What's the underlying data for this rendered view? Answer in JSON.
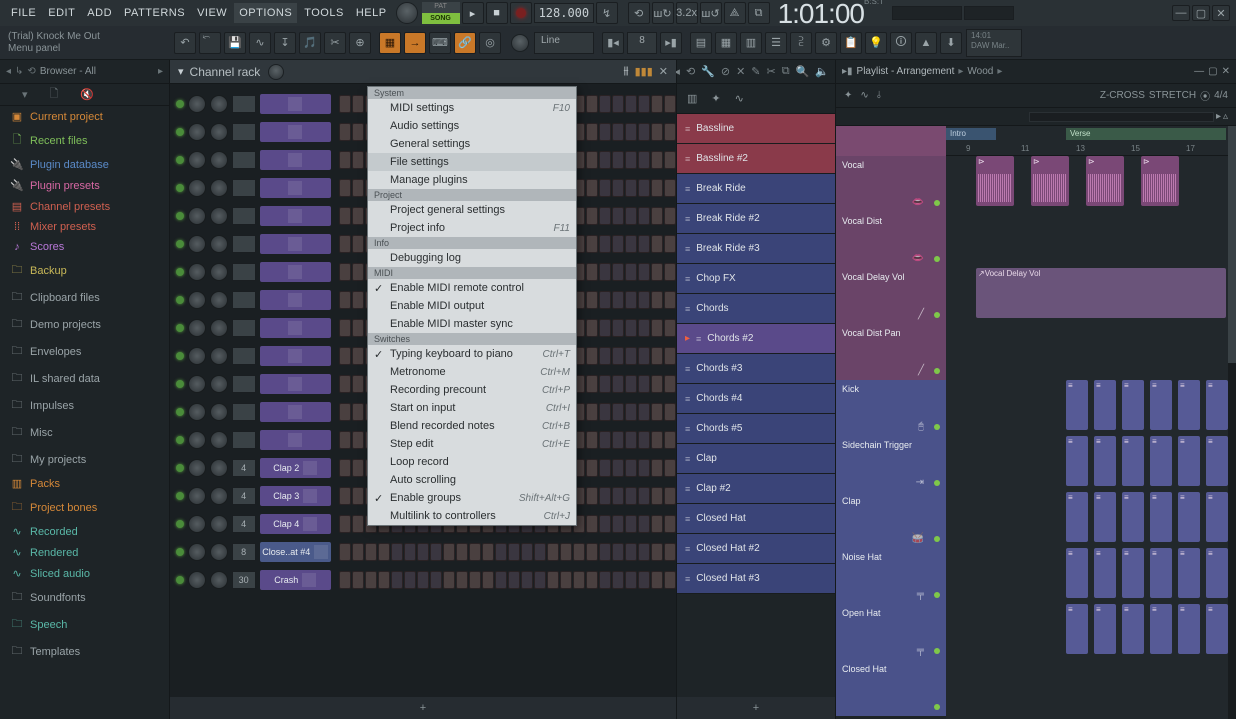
{
  "menu": [
    "FILE",
    "EDIT",
    "ADD",
    "PATTERNS",
    "VIEW",
    "OPTIONS",
    "TOOLS",
    "HELP"
  ],
  "menu_active": "OPTIONS",
  "pat_label": "PAT",
  "song_label": "SONG",
  "tempo": "128.000",
  "clock": "1:01:00",
  "clock_mode": "B:S:T",
  "hint_line1": "(Trial) Knock Me Out",
  "hint_line2": "Menu panel",
  "combo_line": "Line",
  "combo_num": "8",
  "daw_time": "14:01",
  "daw_text": "DAW Mar..",
  "browser_title": "Browser - All",
  "browser_items": [
    {
      "label": "Current project",
      "cls": "c-orange",
      "ico": "▣"
    },
    {
      "label": "Recent files",
      "cls": "c-green",
      "ico": "🗋"
    },
    {
      "label": "Plugin database",
      "cls": "c-blue",
      "ico": "🔌"
    },
    {
      "label": "Plugin presets",
      "cls": "c-pink",
      "ico": "🔌"
    },
    {
      "label": "Channel presets",
      "cls": "c-red",
      "ico": "▤"
    },
    {
      "label": "Mixer presets",
      "cls": "c-red",
      "ico": "⁞⁞"
    },
    {
      "label": "Scores",
      "cls": "c-purple",
      "ico": "♪"
    },
    {
      "label": "Backup",
      "cls": "c-yellow",
      "ico": "🗀"
    },
    {
      "label": "Clipboard files",
      "cls": "c-gray",
      "ico": "🗀"
    },
    {
      "label": "Demo projects",
      "cls": "c-gray",
      "ico": "🗀"
    },
    {
      "label": "Envelopes",
      "cls": "c-gray",
      "ico": "🗀"
    },
    {
      "label": "IL shared data",
      "cls": "c-gray",
      "ico": "🗀"
    },
    {
      "label": "Impulses",
      "cls": "c-gray",
      "ico": "🗀"
    },
    {
      "label": "Misc",
      "cls": "c-gray",
      "ico": "🗀"
    },
    {
      "label": "My projects",
      "cls": "c-gray",
      "ico": "🗀"
    },
    {
      "label": "Packs",
      "cls": "c-orange",
      "ico": "▥"
    },
    {
      "label": "Project bones",
      "cls": "c-orange",
      "ico": "🗀"
    },
    {
      "label": "Recorded",
      "cls": "c-teal",
      "ico": "∿"
    },
    {
      "label": "Rendered",
      "cls": "c-teal",
      "ico": "∿"
    },
    {
      "label": "Sliced audio",
      "cls": "c-teal",
      "ico": "∿"
    },
    {
      "label": "Soundfonts",
      "cls": "c-gray",
      "ico": "🗀"
    },
    {
      "label": "Speech",
      "cls": "c-teal",
      "ico": "🗀"
    },
    {
      "label": "Templates",
      "cls": "c-gray",
      "ico": "🗀"
    }
  ],
  "options_menu": {
    "sections": [
      {
        "title": "System",
        "items": [
          {
            "label": "MIDI settings",
            "shortcut": "F10"
          },
          {
            "label": "Audio settings"
          },
          {
            "label": "General settings"
          },
          {
            "label": "File settings",
            "hover": true
          },
          {
            "label": "Manage plugins"
          }
        ]
      },
      {
        "title": "Project",
        "items": [
          {
            "label": "Project general settings"
          },
          {
            "label": "Project info",
            "shortcut": "F11"
          }
        ]
      },
      {
        "title": "Info",
        "items": [
          {
            "label": "Debugging log"
          }
        ]
      },
      {
        "title": "MIDI",
        "items": [
          {
            "label": "Enable MIDI remote control",
            "checked": true
          },
          {
            "label": "Enable MIDI output",
            "checked": false
          },
          {
            "label": "Enable MIDI master sync",
            "checked": false
          }
        ]
      },
      {
        "title": "Switches",
        "items": [
          {
            "label": "Typing keyboard to piano",
            "checked": true,
            "shortcut": "Ctrl+T"
          },
          {
            "label": "Metronome",
            "shortcut": "Ctrl+M"
          },
          {
            "label": "Recording precount",
            "shortcut": "Ctrl+P"
          },
          {
            "label": "Start on input",
            "shortcut": "Ctrl+I"
          },
          {
            "label": "Blend recorded notes",
            "shortcut": "Ctrl+B"
          },
          {
            "label": "Step edit",
            "shortcut": "Ctrl+E"
          },
          {
            "label": "Loop record"
          },
          {
            "label": "Auto scrolling"
          },
          {
            "label": "Enable groups",
            "checked": true,
            "shortcut": "Shift+Alt+G"
          },
          {
            "label": "Multilink to controllers",
            "shortcut": "Ctrl+J"
          }
        ]
      }
    ]
  },
  "channel_rack": {
    "title": "Channel rack",
    "visible_channels": [
      {
        "num": "4",
        "name": "Clap 2",
        "color": "ch-purple"
      },
      {
        "num": "4",
        "name": "Clap 3",
        "color": "ch-purple"
      },
      {
        "num": "4",
        "name": "Clap 4",
        "color": "ch-purple"
      },
      {
        "num": "8",
        "name": "Close..at #4",
        "color": "ch-blue"
      },
      {
        "num": "30",
        "name": "Crash",
        "color": "ch-purple"
      }
    ]
  },
  "pattern_picker": [
    {
      "name": "Bassline",
      "color": "pat-red"
    },
    {
      "name": "Bassline #2",
      "color": "pat-red"
    },
    {
      "name": "Break Ride",
      "color": "pat-blue"
    },
    {
      "name": "Break Ride #2",
      "color": "pat-blue"
    },
    {
      "name": "Break Ride #3",
      "color": "pat-blue"
    },
    {
      "name": "Chop FX",
      "color": "pat-blue"
    },
    {
      "name": "Chords",
      "color": "pat-blue"
    },
    {
      "name": "Chords #2",
      "color": "pat-purple",
      "sel": true
    },
    {
      "name": "Chords #3",
      "color": "pat-blue"
    },
    {
      "name": "Chords #4",
      "color": "pat-blue"
    },
    {
      "name": "Chords #5",
      "color": "pat-blue"
    },
    {
      "name": "Clap",
      "color": "pat-blue"
    },
    {
      "name": "Clap #2",
      "color": "pat-blue"
    },
    {
      "name": "Closed Hat",
      "color": "pat-blue"
    },
    {
      "name": "Closed Hat #2",
      "color": "pat-blue"
    },
    {
      "name": "Closed Hat #3",
      "color": "pat-blue"
    }
  ],
  "playlist": {
    "title": "Playlist - Arrangement",
    "arrangement": "Wood",
    "timesig_icon": "⦿",
    "timesig": "4/4",
    "bars": [
      "9",
      "11",
      "13",
      "15",
      "17"
    ],
    "sections": [
      {
        "name": "Intro"
      },
      {
        "name": "Verse"
      }
    ],
    "zcross": "Z-CROSS",
    "stretch": "STRETCH",
    "tracks": [
      {
        "name": "Vocal",
        "color": "purple",
        "sym": "👄"
      },
      {
        "name": "Vocal Dist",
        "color": "purple",
        "sym": "👄"
      },
      {
        "name": "Vocal Delay Vol",
        "color": "purple",
        "sym": "╱"
      },
      {
        "name": "Vocal Dist Pan",
        "color": "purple",
        "sym": "╱"
      },
      {
        "name": "Kick",
        "color": "blue",
        "sym": "🖰"
      },
      {
        "name": "Sidechain Trigger",
        "color": "blue",
        "sym": "⇥"
      },
      {
        "name": "Clap",
        "color": "blue",
        "sym": "🥁"
      },
      {
        "name": "Noise Hat",
        "color": "blue",
        "sym": "╤"
      },
      {
        "name": "Open Hat",
        "color": "blue",
        "sym": "╤"
      },
      {
        "name": "Closed Hat",
        "color": "blue",
        "sym": ""
      }
    ],
    "clip_delay": "Vocal Delay Vol"
  }
}
